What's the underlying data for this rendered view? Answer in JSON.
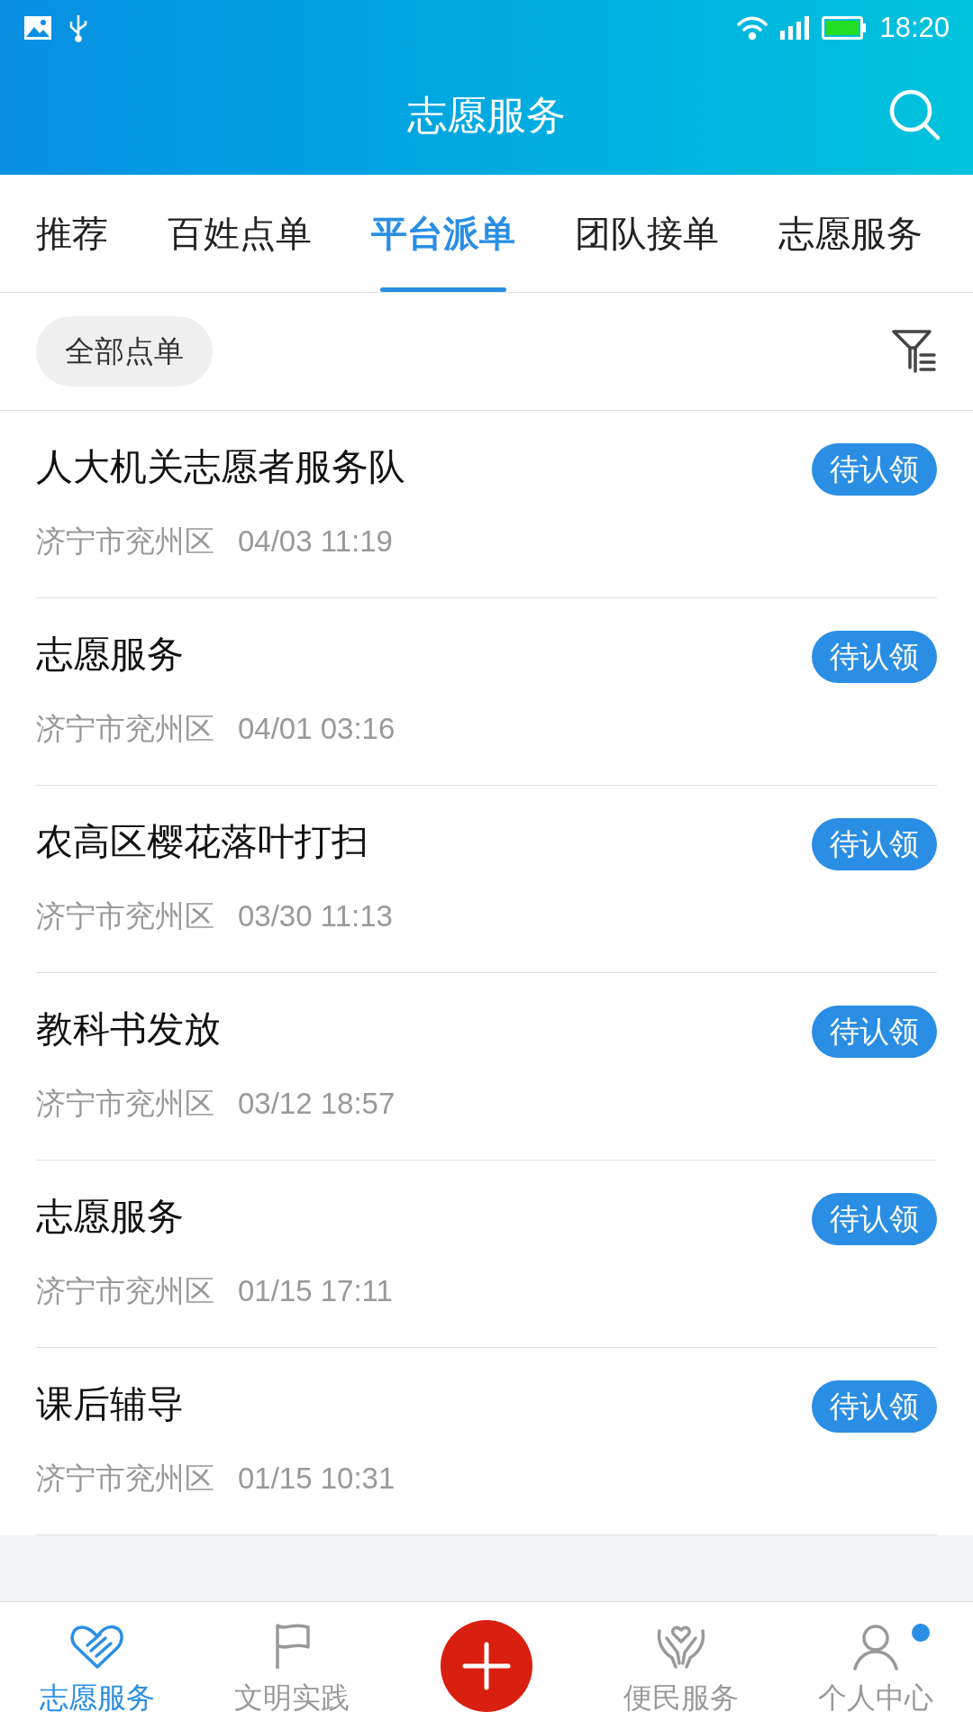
{
  "status_bar": {
    "time": "18:20"
  },
  "header": {
    "title": "志愿服务"
  },
  "tabs": [
    {
      "label": "推荐",
      "selected": false
    },
    {
      "label": "百姓点单",
      "selected": false
    },
    {
      "label": "平台派单",
      "selected": true
    },
    {
      "label": "团队接单",
      "selected": false
    },
    {
      "label": "志愿服务",
      "selected": false
    }
  ],
  "filter": {
    "chip": "全部点单"
  },
  "orders": [
    {
      "title": "人大机关志愿者服务队",
      "location": "济宁市兖州区",
      "time": "04/03 11:19",
      "status": "待认领"
    },
    {
      "title": "志愿服务",
      "location": "济宁市兖州区",
      "time": "04/01 03:16",
      "status": "待认领"
    },
    {
      "title": "农高区樱花落叶打扫",
      "location": "济宁市兖州区",
      "time": "03/30 11:13",
      "status": "待认领"
    },
    {
      "title": "教科书发放",
      "location": "济宁市兖州区",
      "time": "03/12 18:57",
      "status": "待认领"
    },
    {
      "title": "志愿服务",
      "location": "济宁市兖州区",
      "time": "01/15 17:11",
      "status": "待认领"
    },
    {
      "title": "课后辅导",
      "location": "济宁市兖州区",
      "time": "01/15 10:31",
      "status": "待认领"
    }
  ],
  "bottom_nav": [
    {
      "kind": "heart",
      "label": "志愿服务",
      "selected": true,
      "badge": false
    },
    {
      "kind": "flag",
      "label": "文明实践",
      "selected": false,
      "badge": false
    },
    {
      "kind": "add",
      "selected": false
    },
    {
      "kind": "hands",
      "label": "便民服务",
      "selected": false,
      "badge": false
    },
    {
      "kind": "person",
      "label": "个人中心",
      "selected": false,
      "badge": true
    }
  ]
}
